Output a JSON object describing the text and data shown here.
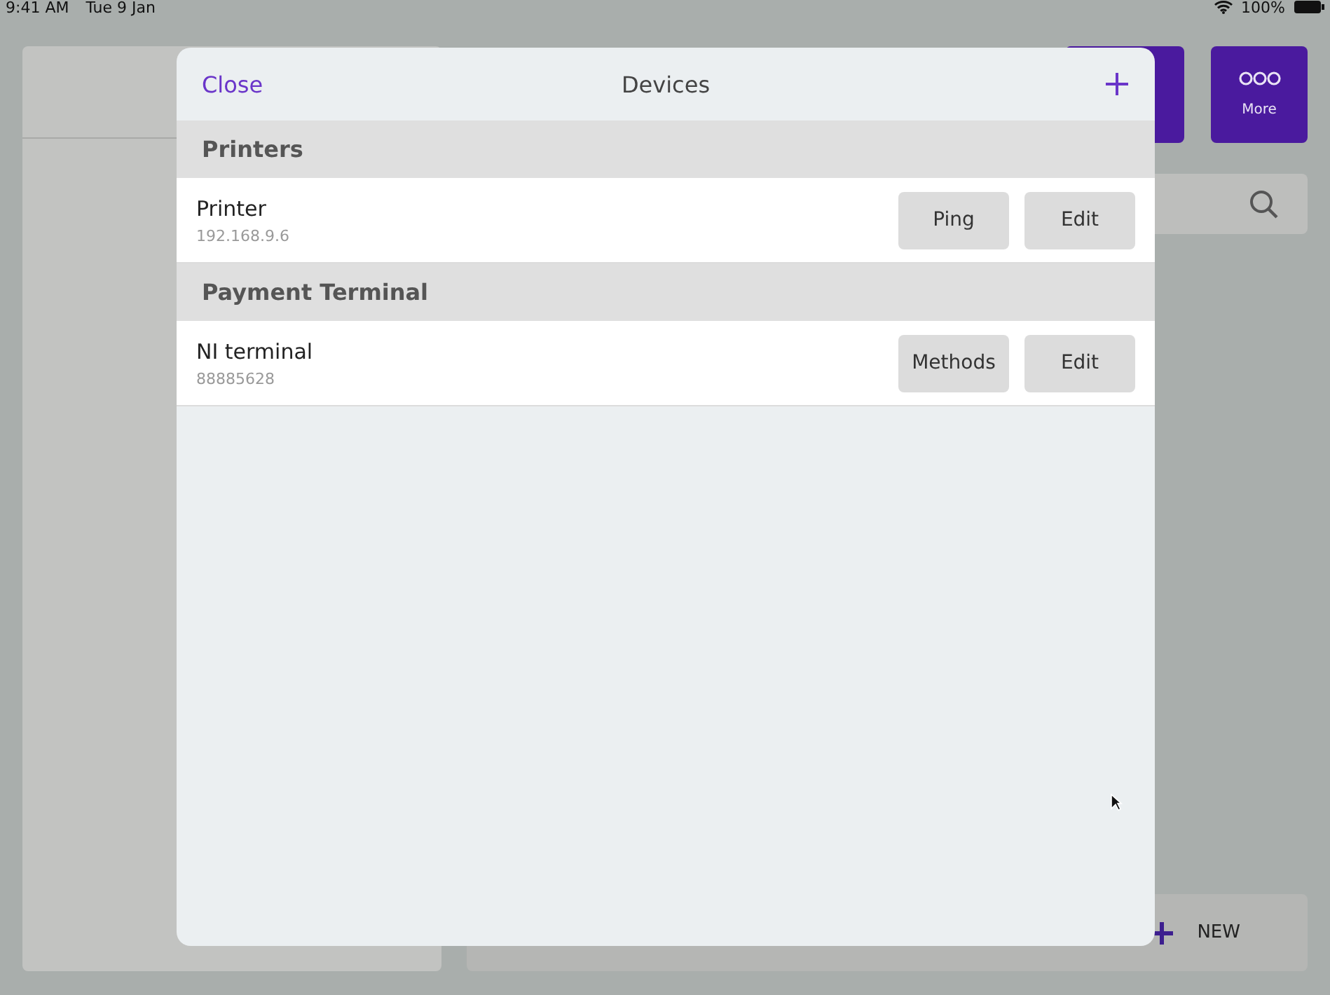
{
  "status_bar": {
    "time": "9:41 AM",
    "date": "Tue 9 Jan",
    "battery": "100%"
  },
  "background": {
    "more_button": {
      "label": "More"
    },
    "new_button": {
      "label": "NEW"
    }
  },
  "dialog": {
    "close": "Close",
    "title": "Devices",
    "sections": [
      {
        "title": "Printers",
        "devices": [
          {
            "name": "Printer",
            "detail": "192.168.9.6",
            "buttons": [
              "Ping",
              "Edit"
            ]
          }
        ]
      },
      {
        "title": "Payment Terminal",
        "devices": [
          {
            "name": "NI terminal",
            "detail": "88885628",
            "buttons": [
              "Methods",
              "Edit"
            ]
          }
        ]
      }
    ]
  }
}
